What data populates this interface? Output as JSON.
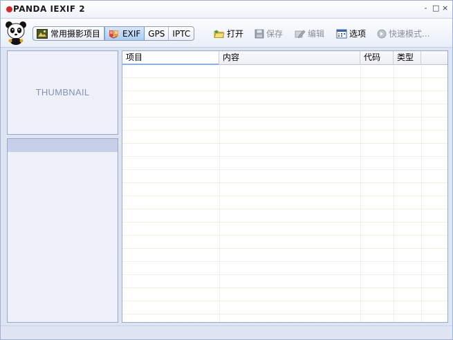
{
  "window": {
    "title": "PANDA IEXIF 2",
    "controls": {
      "minimize": "-",
      "restore": "□",
      "close": "×"
    }
  },
  "toolbar": {
    "tabs": [
      {
        "label": "常用摄影项目",
        "icon": "camera-icon",
        "active": false
      },
      {
        "label": "EXIF",
        "icon": "exif-icon",
        "active": true
      },
      {
        "label": "GPS",
        "active": false
      },
      {
        "label": "IPTC",
        "active": false
      }
    ],
    "buttons": [
      {
        "label": "打开",
        "icon": "open-folder-icon",
        "enabled": true
      },
      {
        "label": "保存",
        "icon": "save-icon",
        "enabled": false
      },
      {
        "label": "编辑",
        "icon": "edit-icon",
        "enabled": false
      },
      {
        "label": "选项",
        "icon": "options-icon",
        "enabled": true
      },
      {
        "label": "快速模式...",
        "icon": "quick-mode-icon",
        "enabled": false
      }
    ]
  },
  "thumbnail": {
    "label": "THUMBNAIL"
  },
  "grid": {
    "columns": [
      "项目",
      "内容",
      "代码",
      "类型",
      ""
    ],
    "sorted_column": "项目"
  },
  "colors": {
    "accent": "#a9cdf3",
    "title_dot": "#d8262b",
    "panel_bg": "#eef1fa",
    "window_bg": "#dde4f2"
  }
}
